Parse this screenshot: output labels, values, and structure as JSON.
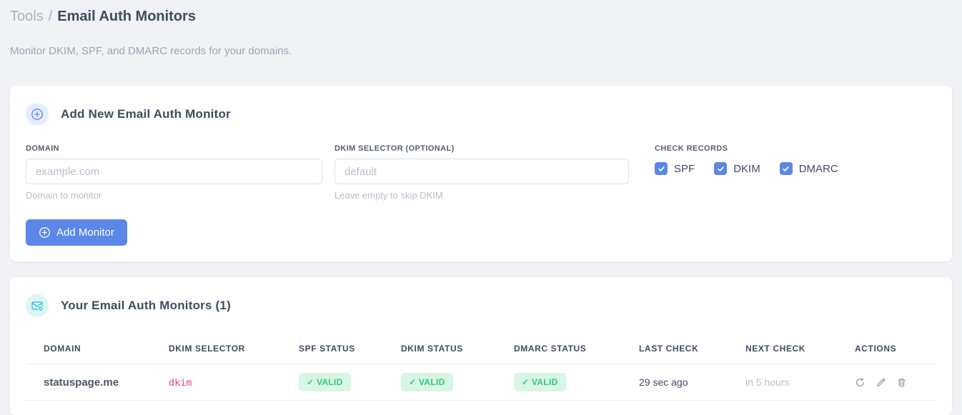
{
  "page": {
    "breadcrumb": {
      "section": "Tools",
      "separator": "/",
      "current": "Email Auth Monitors"
    },
    "subtitle": "Monitor DKIM, SPF, and DMARC records for your domains."
  },
  "add_monitor_card": {
    "title": "Add New Email Auth Monitor",
    "header_icon": "plus-circle-icon",
    "fields": {
      "domain": {
        "label": "DOMAIN",
        "value": "",
        "placeholder": "example.com",
        "helper": "Domain to monitor"
      },
      "dkim_selector": {
        "label": "DKIM SELECTOR (OPTIONAL)",
        "value": "",
        "placeholder": "default",
        "helper": "Leave empty to skip DKIM"
      }
    },
    "check_records": {
      "label": "CHECK RECORDS",
      "options": [
        {
          "label": "SPF",
          "checked": true
        },
        {
          "label": "DKIM",
          "checked": true
        },
        {
          "label": "DMARC",
          "checked": true
        }
      ]
    },
    "submit": {
      "label": "Add Monitor",
      "icon": "plus-circle-icon"
    }
  },
  "monitors_card": {
    "title": "Your Email Auth Monitors (1)",
    "count": 1,
    "header_icon": "mail-check-icon",
    "table": {
      "columns": [
        "DOMAIN",
        "DKIM SELECTOR",
        "SPF STATUS",
        "DKIM STATUS",
        "DMARC STATUS",
        "LAST CHECK",
        "NEXT CHECK",
        "ACTIONS"
      ],
      "rows": [
        {
          "domain": "statuspage.me",
          "dkim_selector": "dkim",
          "spf_status": "✓ VALID",
          "dkim_status": "✓ VALID",
          "dmarc_status": "✓ VALID",
          "last_check": "29 sec ago",
          "next_check": "in 5 hours",
          "actions": [
            "refresh",
            "edit",
            "delete"
          ]
        }
      ]
    }
  },
  "colors": {
    "accent_blue": "#5b87e8",
    "accent_cyan": "#35c5d6",
    "valid_green_text": "#2dcb73",
    "valid_green_bg": "#d9f5e5",
    "selector_pink": "#e8437e",
    "page_bg": "#f1f2f5",
    "heading_slate": "#3e4b63",
    "muted_gray": "#b6bdc9"
  }
}
